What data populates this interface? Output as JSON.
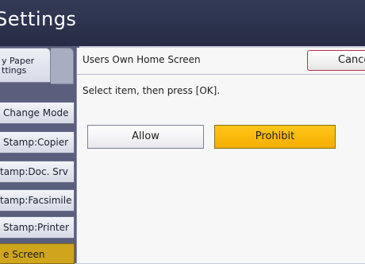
{
  "window": {
    "title": "Settings"
  },
  "left_tabs": {
    "paper_settings_label": "y Paper\nttings"
  },
  "sidebar": {
    "items": [
      {
        "label": "Change Mode",
        "active": false
      },
      {
        "label": "Stamp:Copier",
        "active": false
      },
      {
        "label": "tamp:Doc. Srv",
        "active": false
      },
      {
        "label": "tamp:Facsimile",
        "active": false
      },
      {
        "label": "Stamp:Printer",
        "active": false
      },
      {
        "label": "e Screen",
        "active": true
      }
    ]
  },
  "dialog": {
    "title": "Users Own Home Screen",
    "cancel_label": "Cancel",
    "instruction": "Select item, then press [OK].",
    "options": [
      {
        "label": "Allow",
        "selected": false
      },
      {
        "label": "Prohibit",
        "selected": true
      }
    ]
  },
  "colors": {
    "titlebar": "#2c3350",
    "selected_option": "#f9b700",
    "active_sidebar": "#cfa51e",
    "cancel_border": "#b0344a"
  }
}
